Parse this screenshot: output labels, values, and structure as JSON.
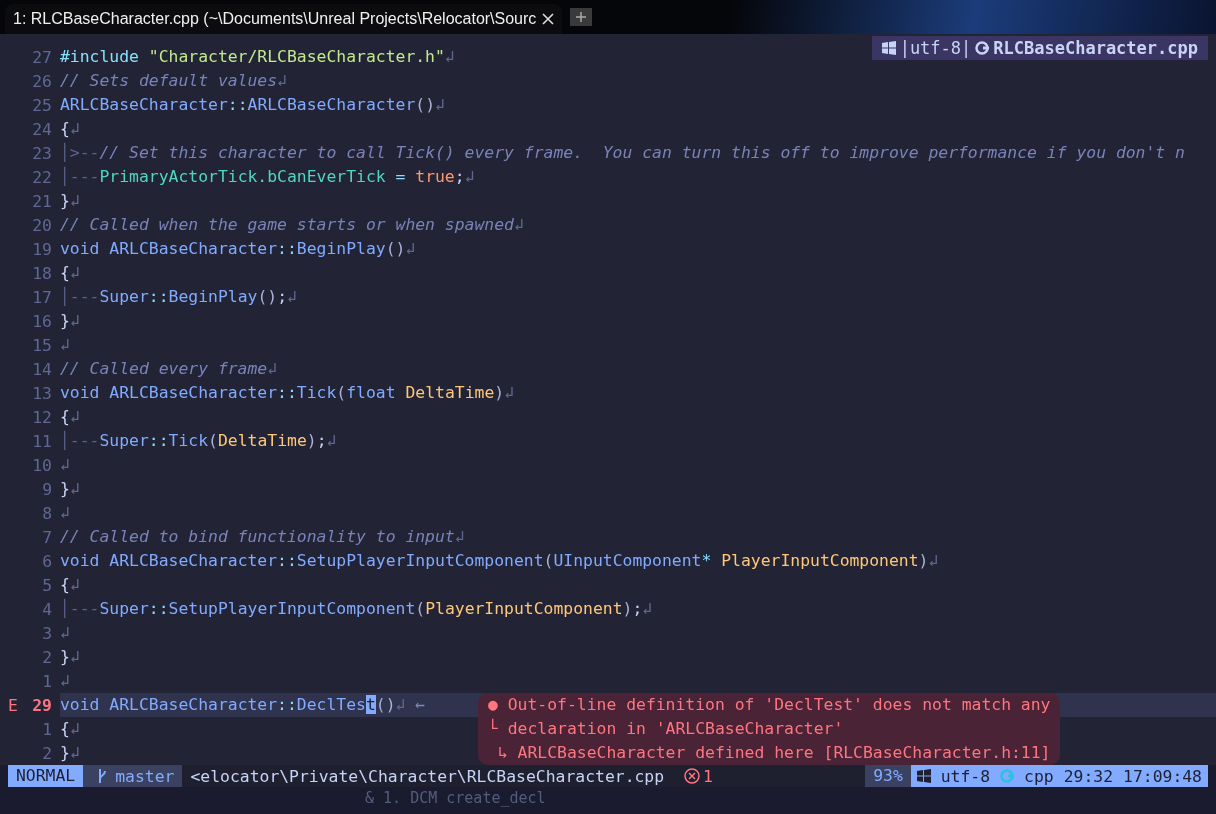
{
  "tab": {
    "title": "1: RLCBaseCharacter.cpp (~\\Documents\\Unreal Projects\\Relocator\\Sourc",
    "selected": true
  },
  "winbar": {
    "encoding": "|utf-8|",
    "filename": "RLCBaseCharacter.cpp"
  },
  "lines": [
    {
      "number": "27",
      "current": false,
      "tokens": [
        {
          "kind": "pre",
          "text": "#include "
        },
        {
          "kind": "str",
          "text": "\"Character/RLCBaseCharacter.h\""
        },
        {
          "kind": "eol",
          "text": "↲"
        }
      ]
    },
    {
      "number": "26",
      "current": false,
      "tokens": [
        {
          "kind": "cm",
          "text": "// Sets default values"
        },
        {
          "kind": "eol",
          "text": "↲"
        }
      ]
    },
    {
      "number": "25",
      "current": false,
      "tokens": [
        {
          "kind": "type",
          "text": "ARLCBaseCharacter"
        },
        {
          "kind": "op",
          "text": "::"
        },
        {
          "kind": "fn",
          "text": "ARLCBaseCharacter"
        },
        {
          "kind": "paren",
          "text": "()"
        },
        {
          "kind": "eol",
          "text": "↲"
        }
      ]
    },
    {
      "number": "24",
      "current": false,
      "tokens": [
        {
          "kind": "plain",
          "text": "{"
        },
        {
          "kind": "eol",
          "text": "↲"
        }
      ]
    },
    {
      "number": "23",
      "current": false,
      "tokens": [
        {
          "kind": "guide",
          "text": "│>--"
        },
        {
          "kind": "cm",
          "text": "// Set this character to call Tick() every frame.  You can turn this off to improve performance if you don't n"
        }
      ]
    },
    {
      "number": "22",
      "current": false,
      "tokens": [
        {
          "kind": "guide",
          "text": "│---"
        },
        {
          "kind": "field",
          "text": "PrimaryActorTick.bCanEverTick"
        },
        {
          "kind": "op",
          "text": " = "
        },
        {
          "kind": "bool",
          "text": "true"
        },
        {
          "kind": "plain",
          "text": ";"
        },
        {
          "kind": "eol",
          "text": "↲"
        }
      ]
    },
    {
      "number": "21",
      "current": false,
      "tokens": [
        {
          "kind": "plain",
          "text": "}"
        },
        {
          "kind": "eol",
          "text": "↲"
        }
      ]
    },
    {
      "number": "20",
      "current": false,
      "tokens": [
        {
          "kind": "cm",
          "text": "// Called when the game starts or when spawned"
        },
        {
          "kind": "eol",
          "text": "↲"
        }
      ]
    },
    {
      "number": "19",
      "current": false,
      "tokens": [
        {
          "kind": "kw",
          "text": "void "
        },
        {
          "kind": "type",
          "text": "ARLCBaseCharacter"
        },
        {
          "kind": "op",
          "text": "::"
        },
        {
          "kind": "fn",
          "text": "BeginPlay"
        },
        {
          "kind": "paren",
          "text": "()"
        },
        {
          "kind": "eol",
          "text": "↲"
        }
      ]
    },
    {
      "number": "18",
      "current": false,
      "tokens": [
        {
          "kind": "plain",
          "text": "{"
        },
        {
          "kind": "eol",
          "text": "↲"
        }
      ]
    },
    {
      "number": "17",
      "current": false,
      "tokens": [
        {
          "kind": "guide",
          "text": "│---"
        },
        {
          "kind": "type",
          "text": "Super"
        },
        {
          "kind": "op",
          "text": "::"
        },
        {
          "kind": "fn",
          "text": "BeginPlay"
        },
        {
          "kind": "paren",
          "text": "()"
        },
        {
          "kind": "plain",
          "text": ";"
        },
        {
          "kind": "eol",
          "text": "↲"
        }
      ]
    },
    {
      "number": "16",
      "current": false,
      "tokens": [
        {
          "kind": "plain",
          "text": "}"
        },
        {
          "kind": "eol",
          "text": "↲"
        }
      ]
    },
    {
      "number": "15",
      "current": false,
      "tokens": [
        {
          "kind": "eol",
          "text": "↲"
        }
      ]
    },
    {
      "number": "14",
      "current": false,
      "tokens": [
        {
          "kind": "cm",
          "text": "// Called every frame"
        },
        {
          "kind": "eol",
          "text": "↲"
        }
      ]
    },
    {
      "number": "13",
      "current": false,
      "tokens": [
        {
          "kind": "kw",
          "text": "void "
        },
        {
          "kind": "type",
          "text": "ARLCBaseCharacter"
        },
        {
          "kind": "op",
          "text": "::"
        },
        {
          "kind": "fn",
          "text": "Tick"
        },
        {
          "kind": "paren",
          "text": "("
        },
        {
          "kind": "kw",
          "text": "float "
        },
        {
          "kind": "param",
          "text": "DeltaTime"
        },
        {
          "kind": "paren",
          "text": ")"
        },
        {
          "kind": "eol",
          "text": "↲"
        }
      ]
    },
    {
      "number": "12",
      "current": false,
      "tokens": [
        {
          "kind": "plain",
          "text": "{"
        },
        {
          "kind": "eol",
          "text": "↲"
        }
      ]
    },
    {
      "number": "11",
      "current": false,
      "tokens": [
        {
          "kind": "guide",
          "text": "│---"
        },
        {
          "kind": "type",
          "text": "Super"
        },
        {
          "kind": "op",
          "text": "::"
        },
        {
          "kind": "fn",
          "text": "Tick"
        },
        {
          "kind": "paren",
          "text": "("
        },
        {
          "kind": "param",
          "text": "DeltaTime"
        },
        {
          "kind": "paren",
          "text": ")"
        },
        {
          "kind": "plain",
          "text": ";"
        },
        {
          "kind": "eol",
          "text": "↲"
        }
      ]
    },
    {
      "number": "10",
      "current": false,
      "tokens": [
        {
          "kind": "eol",
          "text": "↲"
        }
      ]
    },
    {
      "number": "9",
      "current": false,
      "tokens": [
        {
          "kind": "plain",
          "text": "}"
        },
        {
          "kind": "eol",
          "text": "↲"
        }
      ]
    },
    {
      "number": "8",
      "current": false,
      "tokens": [
        {
          "kind": "eol",
          "text": "↲"
        }
      ]
    },
    {
      "number": "7",
      "current": false,
      "tokens": [
        {
          "kind": "cm",
          "text": "// Called to bind functionality to input"
        },
        {
          "kind": "eol",
          "text": "↲"
        }
      ]
    },
    {
      "number": "6",
      "current": false,
      "tokens": [
        {
          "kind": "kw",
          "text": "void "
        },
        {
          "kind": "type",
          "text": "ARLCBaseCharacter"
        },
        {
          "kind": "op",
          "text": "::"
        },
        {
          "kind": "fn",
          "text": "SetupPlayerInputComponent"
        },
        {
          "kind": "paren",
          "text": "("
        },
        {
          "kind": "type",
          "text": "UInputComponent"
        },
        {
          "kind": "op",
          "text": "* "
        },
        {
          "kind": "param",
          "text": "PlayerInputComponent"
        },
        {
          "kind": "paren",
          "text": ")"
        },
        {
          "kind": "eol",
          "text": "↲"
        }
      ]
    },
    {
      "number": "5",
      "current": false,
      "tokens": [
        {
          "kind": "plain",
          "text": "{"
        },
        {
          "kind": "eol",
          "text": "↲"
        }
      ]
    },
    {
      "number": "4",
      "current": false,
      "tokens": [
        {
          "kind": "guide",
          "text": "│---"
        },
        {
          "kind": "type",
          "text": "Super"
        },
        {
          "kind": "op",
          "text": "::"
        },
        {
          "kind": "fn",
          "text": "SetupPlayerInputComponent"
        },
        {
          "kind": "paren",
          "text": "("
        },
        {
          "kind": "param",
          "text": "PlayerInputComponent"
        },
        {
          "kind": "paren",
          "text": ")"
        },
        {
          "kind": "plain",
          "text": ";"
        },
        {
          "kind": "eol",
          "text": "↲"
        }
      ]
    },
    {
      "number": "3",
      "current": false,
      "tokens": [
        {
          "kind": "eol",
          "text": "↲"
        }
      ]
    },
    {
      "number": "2",
      "current": false,
      "tokens": [
        {
          "kind": "plain",
          "text": "}"
        },
        {
          "kind": "eol",
          "text": "↲"
        }
      ]
    },
    {
      "number": "1",
      "current": false,
      "tokens": [
        {
          "kind": "eol",
          "text": "↲"
        }
      ]
    },
    {
      "number": "29",
      "current": true,
      "sign": "E",
      "tokens": [
        {
          "kind": "kw",
          "text": "void "
        },
        {
          "kind": "type",
          "text": "ARLCBaseCharacter"
        },
        {
          "kind": "op",
          "text": "::"
        },
        {
          "kind": "fn",
          "text": "DeclTes"
        },
        {
          "kind": "cursor",
          "text": "t"
        },
        {
          "kind": "paren",
          "text": "()"
        },
        {
          "kind": "eol",
          "text": "↲"
        },
        {
          "kind": "vt",
          "text": " ←"
        }
      ]
    },
    {
      "number": "1",
      "current": false,
      "tokens": [
        {
          "kind": "plain",
          "text": "{"
        },
        {
          "kind": "eol",
          "text": "↲"
        }
      ]
    },
    {
      "number": "2",
      "current": false,
      "tokens": [
        {
          "kind": "plain",
          "text": "}"
        },
        {
          "kind": "eol",
          "text": "↲"
        }
      ]
    }
  ],
  "diagnostic": [
    "● Out-of-line definition of 'DeclTest' does not match any",
    "└ declaration in 'ARLCBaseCharacter'",
    " ↳ ARLCBaseCharacter defined here [RLCBaseCharacter.h:11]"
  ],
  "statusline": {
    "mode": "NORMAL",
    "branch": "master",
    "path": "<elocator\\Private\\Character\\RLCBaseCharacter.cpp",
    "errors": "1",
    "progress": "93%",
    "encoding": "utf-8",
    "filetype": "cpp",
    "position": "29:32",
    "clock": "17:09:48"
  },
  "command_line": "& 1. DCM create_decl"
}
